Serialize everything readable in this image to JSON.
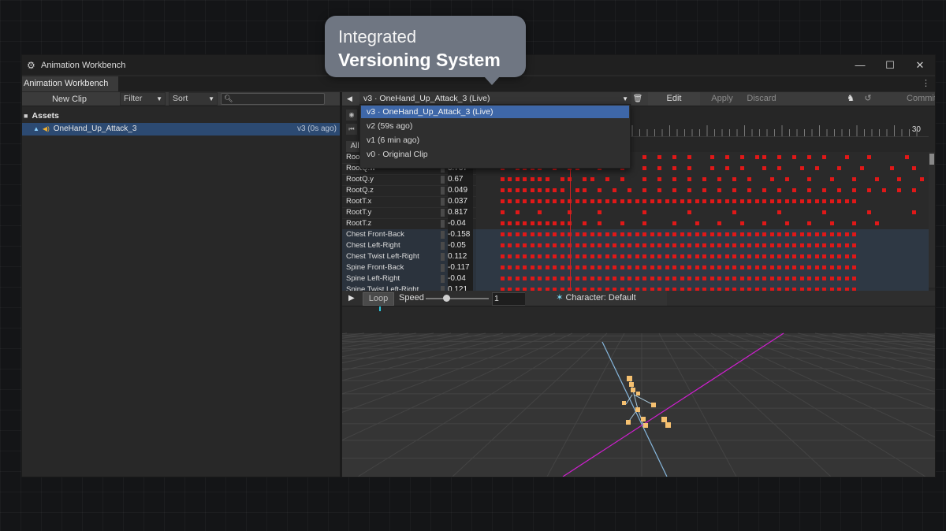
{
  "window": {
    "title": "Animation Workbench",
    "tab": "Animation Workbench"
  },
  "left": {
    "new_clip": "New Clip",
    "filter": "Filter",
    "sort": "Sort",
    "assets_header": "Assets",
    "asset": {
      "name": "OneHand_Up_Attack_3",
      "version": "v3 (0s ago)"
    }
  },
  "toolbar": {
    "version_selected": "v3 · OneHand_Up_Attack_3 (Live)",
    "edit": "Edit",
    "apply": "Apply",
    "discard": "Discard",
    "commit": "Commit"
  },
  "versions": [
    "v3 · OneHand_Up_Attack_3 (Live)",
    "v2 (59s ago)",
    "v1 (6 min ago)",
    "v0 · Original Clip"
  ],
  "timeline": {
    "ruler_end": "30",
    "all_label": "All",
    "tracks": [
      {
        "name": "RootQ.x",
        "value": "",
        "keys": [
          3,
          4,
          5,
          6,
          7,
          10,
          11,
          14,
          19,
          22,
          24,
          26,
          28,
          31,
          33,
          35,
          37,
          38,
          40,
          42,
          44,
          46,
          49,
          52,
          57
        ]
      },
      {
        "name": "RootQ.w",
        "value": "0.707",
        "keys": [
          3,
          5,
          6,
          7,
          8,
          10,
          12,
          13,
          16,
          19,
          22,
          24,
          26,
          28,
          31,
          33,
          35,
          38,
          40,
          43,
          45,
          48,
          51,
          55,
          58
        ]
      },
      {
        "name": "RootQ.y",
        "value": "0.67",
        "keys": [
          3,
          4,
          5,
          6,
          7,
          8,
          9,
          11,
          12,
          14,
          15,
          17,
          19,
          22,
          24,
          26,
          28,
          30,
          32,
          34,
          36,
          39,
          41,
          44,
          47,
          50,
          53,
          56,
          59
        ]
      },
      {
        "name": "RootQ.z",
        "value": "0.049",
        "keys": [
          3,
          4,
          5,
          6,
          7,
          8,
          9,
          10,
          11,
          13,
          14,
          16,
          18,
          20,
          22,
          24,
          26,
          28,
          30,
          32,
          34,
          36,
          38,
          40,
          42,
          44,
          46,
          48,
          50,
          52,
          54,
          56,
          58
        ]
      },
      {
        "name": "RootT.x",
        "value": "0.037",
        "keys": [
          3,
          4,
          5,
          6,
          7,
          8,
          9,
          10,
          11,
          12,
          13,
          14,
          15,
          16,
          17,
          18,
          19,
          20,
          21,
          22,
          23,
          24,
          25,
          26,
          27,
          28,
          29,
          30,
          31,
          32,
          33,
          34,
          35,
          36,
          37,
          38,
          39,
          40,
          41,
          42,
          43,
          44,
          45,
          46,
          47,
          48,
          49,
          50
        ]
      },
      {
        "name": "RootT.y",
        "value": "0.817",
        "keys": [
          3,
          5,
          8,
          12,
          16,
          22,
          28,
          34,
          40,
          46,
          52,
          58
        ]
      },
      {
        "name": "RootT.z",
        "value": "-0.04",
        "keys": [
          3,
          4,
          5,
          6,
          7,
          8,
          9,
          10,
          11,
          12,
          14,
          16,
          19,
          22,
          26,
          29,
          32,
          35,
          38,
          41,
          44,
          47,
          50,
          53
        ]
      },
      {
        "name": "Chest Front-Back",
        "value": "-0.158",
        "keys": [
          3,
          4,
          5,
          6,
          7,
          8,
          9,
          10,
          11,
          12,
          13,
          14,
          15,
          16,
          17,
          18,
          19,
          20,
          21,
          22,
          23,
          24,
          25,
          26,
          27,
          28,
          29,
          30,
          31,
          32,
          33,
          34,
          35,
          36,
          37,
          38,
          39,
          40,
          41,
          42,
          43,
          44,
          45,
          46,
          47,
          48,
          49,
          50
        ]
      },
      {
        "name": "Chest Left-Right",
        "value": "-0.05",
        "keys": [
          3,
          4,
          5,
          6,
          7,
          8,
          9,
          10,
          11,
          12,
          13,
          14,
          15,
          16,
          17,
          18,
          19,
          20,
          21,
          22,
          23,
          24,
          25,
          26,
          27,
          28,
          29,
          30,
          31,
          32,
          33,
          34,
          35,
          36,
          37,
          38,
          39,
          40,
          41,
          42,
          43,
          44,
          45,
          46,
          47,
          48,
          49,
          50
        ]
      },
      {
        "name": "Chest Twist Left-Right",
        "value": "0.112",
        "keys": [
          3,
          4,
          5,
          6,
          7,
          8,
          9,
          10,
          11,
          12,
          13,
          14,
          15,
          16,
          17,
          18,
          19,
          20,
          21,
          22,
          23,
          24,
          25,
          26,
          27,
          28,
          29,
          30,
          31,
          32,
          33,
          34,
          35,
          36,
          37,
          38,
          39,
          40,
          41,
          42,
          43,
          44,
          45,
          46,
          47,
          48,
          49,
          50
        ]
      },
      {
        "name": "Spine Front-Back",
        "value": "-0.117",
        "keys": [
          3,
          4,
          5,
          6,
          7,
          8,
          9,
          10,
          11,
          12,
          13,
          14,
          15,
          16,
          17,
          18,
          19,
          20,
          21,
          22,
          23,
          24,
          25,
          26,
          27,
          28,
          29,
          30,
          31,
          32,
          33,
          34,
          35,
          36,
          37,
          38,
          39,
          40,
          41,
          42,
          43,
          44,
          45,
          46,
          47,
          48,
          49,
          50
        ]
      },
      {
        "name": "Spine Left-Right",
        "value": "-0.04",
        "keys": [
          3,
          4,
          5,
          6,
          7,
          8,
          9,
          10,
          11,
          12,
          13,
          14,
          15,
          16,
          17,
          18,
          19,
          20,
          21,
          22,
          23,
          24,
          25,
          26,
          27,
          28,
          29,
          30,
          31,
          32,
          33,
          34,
          35,
          36,
          37,
          38,
          39,
          40,
          41,
          42,
          43,
          44,
          45,
          46,
          47,
          48,
          49,
          50
        ]
      },
      {
        "name": "Spine Twist Left-Right",
        "value": "0.121",
        "keys": [
          3,
          4,
          5,
          6,
          7,
          8,
          9,
          10,
          11,
          12,
          13,
          14,
          15,
          16,
          17,
          18,
          19,
          20,
          21,
          22,
          23,
          24,
          25,
          26,
          27,
          28,
          29,
          30,
          31,
          32,
          33,
          34,
          35,
          36,
          37,
          38,
          39,
          40,
          41,
          42,
          43,
          44,
          45,
          46,
          47,
          48,
          49,
          50
        ]
      }
    ]
  },
  "playbar": {
    "loop": "Loop",
    "speed_label": "Speed",
    "speed_value": "1",
    "character": "Character: Default"
  },
  "callout": {
    "line1": "Integrated",
    "line2": "Versioning System"
  },
  "colors": {
    "keyframe": "#e01818",
    "selection": "#3e67a8",
    "accent_axis_x": "#d01fd0",
    "accent_axis_z": "#7fb8e0",
    "skeleton": "#f5c070"
  }
}
